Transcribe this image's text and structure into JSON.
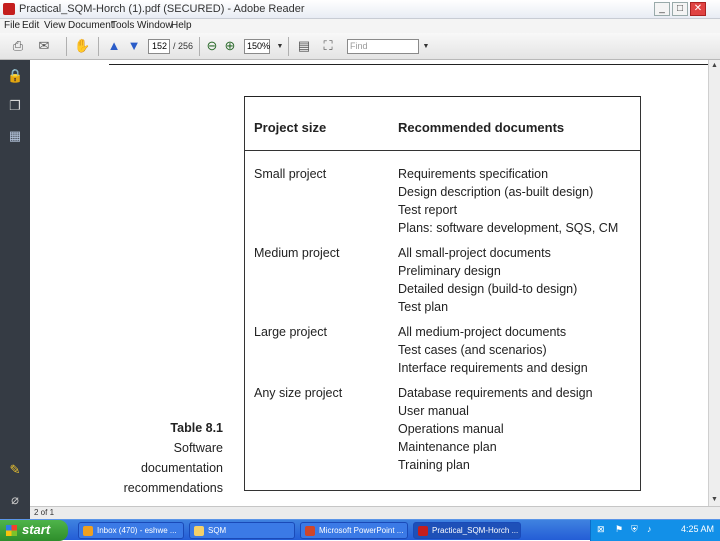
{
  "window": {
    "title": "Practical_SQM-Horch (1).pdf (SECURED) - Adobe Reader",
    "min_label": "_",
    "max_label": "□",
    "close_label": "✕"
  },
  "menu": [
    "File",
    "Edit",
    "View",
    "Document",
    "Tools",
    "Window",
    "Help"
  ],
  "toolbar": {
    "page_current": "152",
    "page_total": "/ 256",
    "zoom": "150%",
    "find_placeholder": "Find"
  },
  "document": {
    "header_col1": "Project size",
    "header_col2": "Recommended documents",
    "rows": [
      {
        "size": "Small project",
        "docs": [
          "Requirements specification",
          "Design description (as-built design)",
          "Test report",
          "Plans: software development, SQS, CM"
        ]
      },
      {
        "size": "Medium project",
        "docs": [
          "All small-project documents",
          "Preliminary design",
          "Detailed design (build-to design)",
          "Test plan"
        ]
      },
      {
        "size": "Large project",
        "docs": [
          "All medium-project documents",
          "Test cases (and scenarios)",
          "Interface requirements and design"
        ]
      },
      {
        "size": "Any size project",
        "docs": [
          "Database requirements and design",
          "User manual",
          "Operations manual",
          "Maintenance plan",
          "Training plan"
        ]
      }
    ],
    "caption": {
      "number": "Table 8.1",
      "lines": [
        "Software",
        "documentation",
        "recommendations"
      ]
    }
  },
  "statusbar": {
    "page_info": "2 of 1"
  },
  "taskbar": {
    "start_label": "start",
    "items": [
      {
        "label": "Inbox (470) - eshwe ...",
        "icon": "browser-icon"
      },
      {
        "label": "SQM",
        "icon": "folder-icon"
      },
      {
        "label": "Microsoft PowerPoint ...",
        "icon": "powerpoint-icon"
      },
      {
        "label": "Practical_SQM-Horch ...",
        "icon": "pdf-icon"
      }
    ],
    "clock": "4:25 AM"
  },
  "colors": {
    "taskbar_blue": "#245dd6",
    "start_green": "#2e8d2b",
    "sidebar_dark": "#353b44",
    "pdf_red": "#c41e1e"
  }
}
